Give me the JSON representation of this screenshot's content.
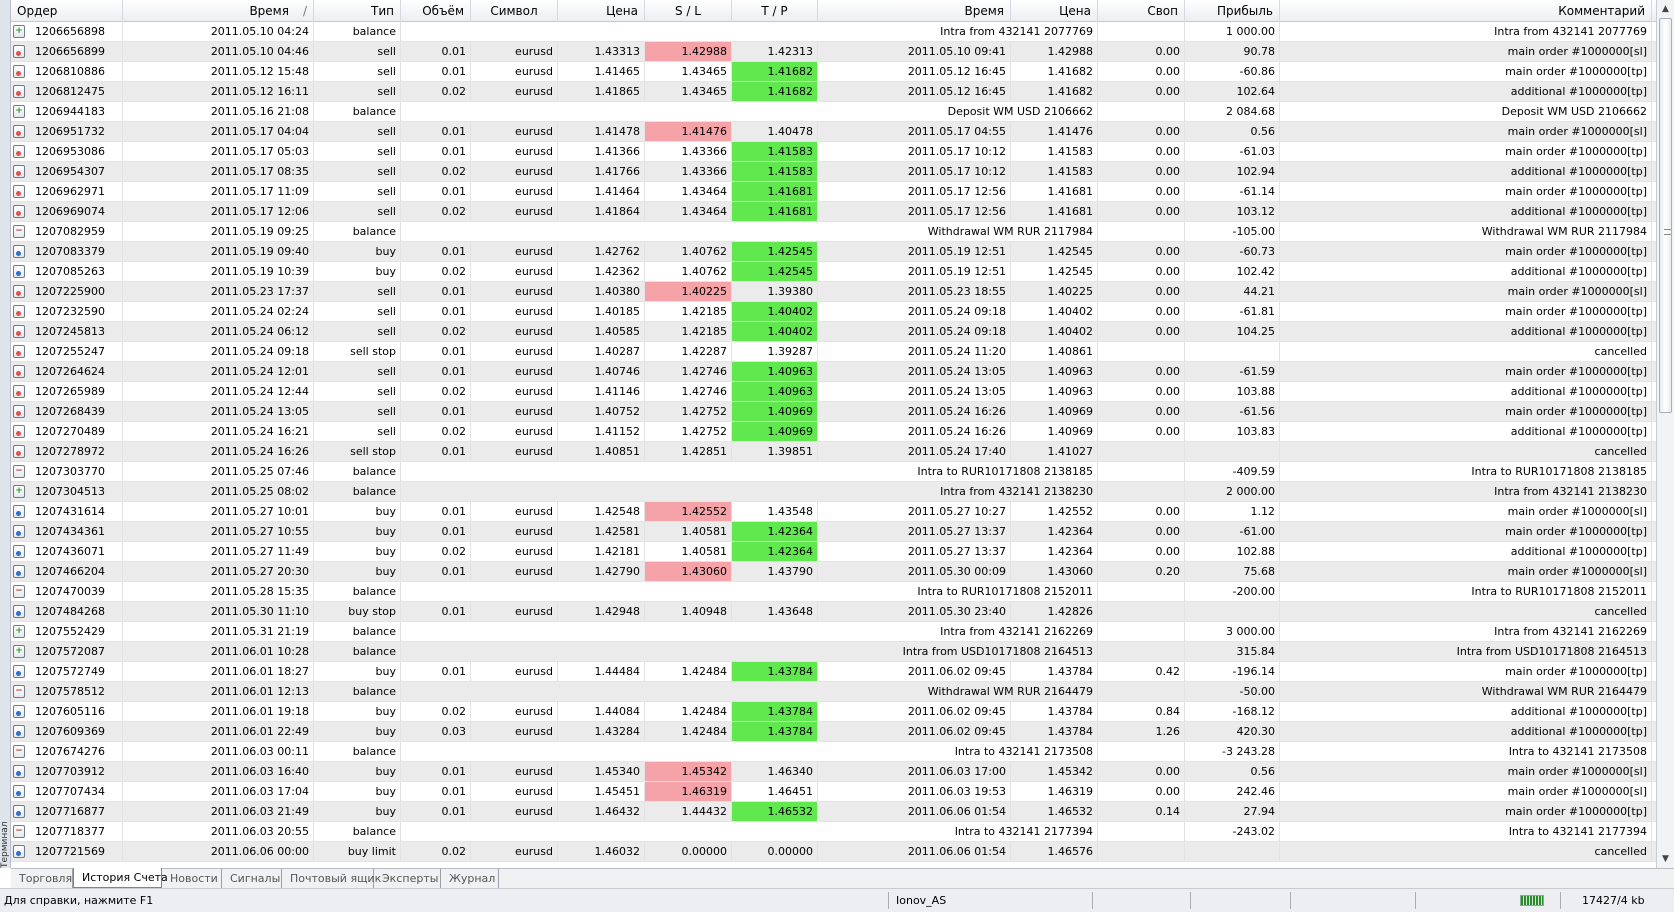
{
  "side_label": "Терминал",
  "columns": [
    "Ордер",
    "Время",
    "Тип",
    "Объём",
    "Символ",
    "Цена",
    "S / L",
    "T / P",
    "Время",
    "Цена",
    "Своп",
    "Прибыль",
    "Комментарий"
  ],
  "sort_indicator": "/",
  "rows": [
    {
      "o": "1206656898",
      "t": "2011.05.10 04:24",
      "ty": "balance",
      "v": "",
      "s": "",
      "p": "",
      "sl": "",
      "tp": "",
      "ct": "",
      "cp": "Intra from 432141 2077769",
      "sw": "",
      "pr": "1 000.00",
      "cm": "Intra from 432141 2077769",
      "hit": ""
    },
    {
      "o": "1206656899",
      "t": "2011.05.10 04:46",
      "ty": "sell",
      "v": "0.01",
      "s": "eurusd",
      "p": "1.43313",
      "sl": "1.42988",
      "tp": "1.42313",
      "ct": "2011.05.10 09:41",
      "cp": "1.42988",
      "sw": "0.00",
      "pr": "90.78",
      "cm": "main order #1000000[sl]",
      "hit": "sl"
    },
    {
      "o": "1206810886",
      "t": "2011.05.12 15:48",
      "ty": "sell",
      "v": "0.01",
      "s": "eurusd",
      "p": "1.41465",
      "sl": "1.43465",
      "tp": "1.41682",
      "ct": "2011.05.12 16:45",
      "cp": "1.41682",
      "sw": "0.00",
      "pr": "-60.86",
      "cm": "main order #1000000[tp]",
      "hit": "tp"
    },
    {
      "o": "1206812475",
      "t": "2011.05.12 16:11",
      "ty": "sell",
      "v": "0.02",
      "s": "eurusd",
      "p": "1.41865",
      "sl": "1.43465",
      "tp": "1.41682",
      "ct": "2011.05.12 16:45",
      "cp": "1.41682",
      "sw": "0.00",
      "pr": "102.64",
      "cm": "additional #1000000[tp]",
      "hit": "tp"
    },
    {
      "o": "1206944183",
      "t": "2011.05.16 21:08",
      "ty": "balance",
      "v": "",
      "s": "",
      "p": "",
      "sl": "",
      "tp": "",
      "ct": "",
      "cp": "Deposit WM USD 2106662",
      "sw": "",
      "pr": "2 084.68",
      "cm": "Deposit WM USD 2106662",
      "hit": ""
    },
    {
      "o": "1206951732",
      "t": "2011.05.17 04:04",
      "ty": "sell",
      "v": "0.01",
      "s": "eurusd",
      "p": "1.41478",
      "sl": "1.41476",
      "tp": "1.40478",
      "ct": "2011.05.17 04:55",
      "cp": "1.41476",
      "sw": "0.00",
      "pr": "0.56",
      "cm": "main order #1000000[sl]",
      "hit": "sl"
    },
    {
      "o": "1206953086",
      "t": "2011.05.17 05:03",
      "ty": "sell",
      "v": "0.01",
      "s": "eurusd",
      "p": "1.41366",
      "sl": "1.43366",
      "tp": "1.41583",
      "ct": "2011.05.17 10:12",
      "cp": "1.41583",
      "sw": "0.00",
      "pr": "-61.03",
      "cm": "main order #1000000[tp]",
      "hit": "tp"
    },
    {
      "o": "1206954307",
      "t": "2011.05.17 08:35",
      "ty": "sell",
      "v": "0.02",
      "s": "eurusd",
      "p": "1.41766",
      "sl": "1.43366",
      "tp": "1.41583",
      "ct": "2011.05.17 10:12",
      "cp": "1.41583",
      "sw": "0.00",
      "pr": "102.94",
      "cm": "additional #1000000[tp]",
      "hit": "tp"
    },
    {
      "o": "1206962971",
      "t": "2011.05.17 11:09",
      "ty": "sell",
      "v": "0.01",
      "s": "eurusd",
      "p": "1.41464",
      "sl": "1.43464",
      "tp": "1.41681",
      "ct": "2011.05.17 12:56",
      "cp": "1.41681",
      "sw": "0.00",
      "pr": "-61.14",
      "cm": "main order #1000000[tp]",
      "hit": "tp"
    },
    {
      "o": "1206969074",
      "t": "2011.05.17 12:06",
      "ty": "sell",
      "v": "0.02",
      "s": "eurusd",
      "p": "1.41864",
      "sl": "1.43464",
      "tp": "1.41681",
      "ct": "2011.05.17 12:56",
      "cp": "1.41681",
      "sw": "0.00",
      "pr": "103.12",
      "cm": "additional #1000000[tp]",
      "hit": "tp"
    },
    {
      "o": "1207082959",
      "t": "2011.05.19 09:25",
      "ty": "balance",
      "v": "",
      "s": "",
      "p": "",
      "sl": "",
      "tp": "",
      "ct": "",
      "cp": "Withdrawal WM RUR 2117984",
      "sw": "",
      "pr": "-105.00",
      "cm": "Withdrawal WM RUR 2117984",
      "hit": ""
    },
    {
      "o": "1207083379",
      "t": "2011.05.19 09:40",
      "ty": "buy",
      "v": "0.01",
      "s": "eurusd",
      "p": "1.42762",
      "sl": "1.40762",
      "tp": "1.42545",
      "ct": "2011.05.19 12:51",
      "cp": "1.42545",
      "sw": "0.00",
      "pr": "-60.73",
      "cm": "main order #1000000[tp]",
      "hit": "tp"
    },
    {
      "o": "1207085263",
      "t": "2011.05.19 10:39",
      "ty": "buy",
      "v": "0.02",
      "s": "eurusd",
      "p": "1.42362",
      "sl": "1.40762",
      "tp": "1.42545",
      "ct": "2011.05.19 12:51",
      "cp": "1.42545",
      "sw": "0.00",
      "pr": "102.42",
      "cm": "additional #1000000[tp]",
      "hit": "tp"
    },
    {
      "o": "1207225900",
      "t": "2011.05.23 17:37",
      "ty": "sell",
      "v": "0.01",
      "s": "eurusd",
      "p": "1.40380",
      "sl": "1.40225",
      "tp": "1.39380",
      "ct": "2011.05.23 18:55",
      "cp": "1.40225",
      "sw": "0.00",
      "pr": "44.21",
      "cm": "main order #1000000[sl]",
      "hit": "sl"
    },
    {
      "o": "1207232590",
      "t": "2011.05.24 02:24",
      "ty": "sell",
      "v": "0.01",
      "s": "eurusd",
      "p": "1.40185",
      "sl": "1.42185",
      "tp": "1.40402",
      "ct": "2011.05.24 09:18",
      "cp": "1.40402",
      "sw": "0.00",
      "pr": "-61.81",
      "cm": "main order #1000000[tp]",
      "hit": "tp"
    },
    {
      "o": "1207245813",
      "t": "2011.05.24 06:12",
      "ty": "sell",
      "v": "0.02",
      "s": "eurusd",
      "p": "1.40585",
      "sl": "1.42185",
      "tp": "1.40402",
      "ct": "2011.05.24 09:18",
      "cp": "1.40402",
      "sw": "0.00",
      "pr": "104.25",
      "cm": "additional #1000000[tp]",
      "hit": "tp"
    },
    {
      "o": "1207255247",
      "t": "2011.05.24 09:18",
      "ty": "sell stop",
      "v": "0.01",
      "s": "eurusd",
      "p": "1.40287",
      "sl": "1.42287",
      "tp": "1.39287",
      "ct": "2011.05.24 11:20",
      "cp": "1.40861",
      "sw": "",
      "pr": "",
      "cm": "cancelled",
      "hit": ""
    },
    {
      "o": "1207264624",
      "t": "2011.05.24 12:01",
      "ty": "sell",
      "v": "0.01",
      "s": "eurusd",
      "p": "1.40746",
      "sl": "1.42746",
      "tp": "1.40963",
      "ct": "2011.05.24 13:05",
      "cp": "1.40963",
      "sw": "0.00",
      "pr": "-61.59",
      "cm": "main order #1000000[tp]",
      "hit": "tp"
    },
    {
      "o": "1207265989",
      "t": "2011.05.24 12:44",
      "ty": "sell",
      "v": "0.02",
      "s": "eurusd",
      "p": "1.41146",
      "sl": "1.42746",
      "tp": "1.40963",
      "ct": "2011.05.24 13:05",
      "cp": "1.40963",
      "sw": "0.00",
      "pr": "103.88",
      "cm": "additional #1000000[tp]",
      "hit": "tp"
    },
    {
      "o": "1207268439",
      "t": "2011.05.24 13:05",
      "ty": "sell",
      "v": "0.01",
      "s": "eurusd",
      "p": "1.40752",
      "sl": "1.42752",
      "tp": "1.40969",
      "ct": "2011.05.24 16:26",
      "cp": "1.40969",
      "sw": "0.00",
      "pr": "-61.56",
      "cm": "main order #1000000[tp]",
      "hit": "tp"
    },
    {
      "o": "1207270489",
      "t": "2011.05.24 16:21",
      "ty": "sell",
      "v": "0.02",
      "s": "eurusd",
      "p": "1.41152",
      "sl": "1.42752",
      "tp": "1.40969",
      "ct": "2011.05.24 16:26",
      "cp": "1.40969",
      "sw": "0.00",
      "pr": "103.83",
      "cm": "additional #1000000[tp]",
      "hit": "tp"
    },
    {
      "o": "1207278972",
      "t": "2011.05.24 16:26",
      "ty": "sell stop",
      "v": "0.01",
      "s": "eurusd",
      "p": "1.40851",
      "sl": "1.42851",
      "tp": "1.39851",
      "ct": "2011.05.24 17:40",
      "cp": "1.41027",
      "sw": "",
      "pr": "",
      "cm": "cancelled",
      "hit": ""
    },
    {
      "o": "1207303770",
      "t": "2011.05.25 07:46",
      "ty": "balance",
      "v": "",
      "s": "",
      "p": "",
      "sl": "",
      "tp": "",
      "ct": "",
      "cp": "Intra to RUR10171808 2138185",
      "sw": "",
      "pr": "-409.59",
      "cm": "Intra to RUR10171808 2138185",
      "hit": ""
    },
    {
      "o": "1207304513",
      "t": "2011.05.25 08:02",
      "ty": "balance",
      "v": "",
      "s": "",
      "p": "",
      "sl": "",
      "tp": "",
      "ct": "",
      "cp": "Intra from 432141 2138230",
      "sw": "",
      "pr": "2 000.00",
      "cm": "Intra from 432141 2138230",
      "hit": ""
    },
    {
      "o": "1207431614",
      "t": "2011.05.27 10:01",
      "ty": "buy",
      "v": "0.01",
      "s": "eurusd",
      "p": "1.42548",
      "sl": "1.42552",
      "tp": "1.43548",
      "ct": "2011.05.27 10:27",
      "cp": "1.42552",
      "sw": "0.00",
      "pr": "1.12",
      "cm": "main order #1000000[sl]",
      "hit": "sl"
    },
    {
      "o": "1207434361",
      "t": "2011.05.27 10:55",
      "ty": "buy",
      "v": "0.01",
      "s": "eurusd",
      "p": "1.42581",
      "sl": "1.40581",
      "tp": "1.42364",
      "ct": "2011.05.27 13:37",
      "cp": "1.42364",
      "sw": "0.00",
      "pr": "-61.00",
      "cm": "main order #1000000[tp]",
      "hit": "tp"
    },
    {
      "o": "1207436071",
      "t": "2011.05.27 11:49",
      "ty": "buy",
      "v": "0.02",
      "s": "eurusd",
      "p": "1.42181",
      "sl": "1.40581",
      "tp": "1.42364",
      "ct": "2011.05.27 13:37",
      "cp": "1.42364",
      "sw": "0.00",
      "pr": "102.88",
      "cm": "additional #1000000[tp]",
      "hit": "tp"
    },
    {
      "o": "1207466204",
      "t": "2011.05.27 20:30",
      "ty": "buy",
      "v": "0.01",
      "s": "eurusd",
      "p": "1.42790",
      "sl": "1.43060",
      "tp": "1.43790",
      "ct": "2011.05.30 00:09",
      "cp": "1.43060",
      "sw": "0.20",
      "pr": "75.68",
      "cm": "main order #1000000[sl]",
      "hit": "sl"
    },
    {
      "o": "1207470039",
      "t": "2011.05.28 15:35",
      "ty": "balance",
      "v": "",
      "s": "",
      "p": "",
      "sl": "",
      "tp": "",
      "ct": "",
      "cp": "Intra to RUR10171808 2152011",
      "sw": "",
      "pr": "-200.00",
      "cm": "Intra to RUR10171808 2152011",
      "hit": ""
    },
    {
      "o": "1207484268",
      "t": "2011.05.30 11:10",
      "ty": "buy stop",
      "v": "0.01",
      "s": "eurusd",
      "p": "1.42948",
      "sl": "1.40948",
      "tp": "1.43648",
      "ct": "2011.05.30 23:40",
      "cp": "1.42826",
      "sw": "",
      "pr": "",
      "cm": "cancelled",
      "hit": ""
    },
    {
      "o": "1207552429",
      "t": "2011.05.31 21:19",
      "ty": "balance",
      "v": "",
      "s": "",
      "p": "",
      "sl": "",
      "tp": "",
      "ct": "",
      "cp": "Intra from 432141 2162269",
      "sw": "",
      "pr": "3 000.00",
      "cm": "Intra from 432141 2162269",
      "hit": ""
    },
    {
      "o": "1207572087",
      "t": "2011.06.01 10:28",
      "ty": "balance",
      "v": "",
      "s": "",
      "p": "",
      "sl": "",
      "tp": "",
      "ct": "",
      "cp": "Intra from USD10171808 2164513",
      "sw": "",
      "pr": "315.84",
      "cm": "Intra from USD10171808 2164513",
      "hit": ""
    },
    {
      "o": "1207572749",
      "t": "2011.06.01 18:27",
      "ty": "buy",
      "v": "0.01",
      "s": "eurusd",
      "p": "1.44484",
      "sl": "1.42484",
      "tp": "1.43784",
      "ct": "2011.06.02 09:45",
      "cp": "1.43784",
      "sw": "0.42",
      "pr": "-196.14",
      "cm": "main order #1000000[tp]",
      "hit": "tp"
    },
    {
      "o": "1207578512",
      "t": "2011.06.01 12:13",
      "ty": "balance",
      "v": "",
      "s": "",
      "p": "",
      "sl": "",
      "tp": "",
      "ct": "",
      "cp": "Withdrawal WM RUR 2164479",
      "sw": "",
      "pr": "-50.00",
      "cm": "Withdrawal WM RUR 2164479",
      "hit": ""
    },
    {
      "o": "1207605116",
      "t": "2011.06.01 19:18",
      "ty": "buy",
      "v": "0.02",
      "s": "eurusd",
      "p": "1.44084",
      "sl": "1.42484",
      "tp": "1.43784",
      "ct": "2011.06.02 09:45",
      "cp": "1.43784",
      "sw": "0.84",
      "pr": "-168.12",
      "cm": "additional #1000000[tp]",
      "hit": "tp"
    },
    {
      "o": "1207609369",
      "t": "2011.06.01 22:49",
      "ty": "buy",
      "v": "0.03",
      "s": "eurusd",
      "p": "1.43284",
      "sl": "1.42484",
      "tp": "1.43784",
      "ct": "2011.06.02 09:45",
      "cp": "1.43784",
      "sw": "1.26",
      "pr": "420.30",
      "cm": "additional #1000000[tp]",
      "hit": "tp"
    },
    {
      "o": "1207674276",
      "t": "2011.06.03 00:11",
      "ty": "balance",
      "v": "",
      "s": "",
      "p": "",
      "sl": "",
      "tp": "",
      "ct": "",
      "cp": "Intra to 432141 2173508",
      "sw": "",
      "pr": "-3 243.28",
      "cm": "Intra to 432141 2173508",
      "hit": ""
    },
    {
      "o": "1207703912",
      "t": "2011.06.03 16:40",
      "ty": "buy",
      "v": "0.01",
      "s": "eurusd",
      "p": "1.45340",
      "sl": "1.45342",
      "tp": "1.46340",
      "ct": "2011.06.03 17:00",
      "cp": "1.45342",
      "sw": "0.00",
      "pr": "0.56",
      "cm": "main order #1000000[sl]",
      "hit": "sl"
    },
    {
      "o": "1207707434",
      "t": "2011.06.03 17:04",
      "ty": "buy",
      "v": "0.01",
      "s": "eurusd",
      "p": "1.45451",
      "sl": "1.46319",
      "tp": "1.46451",
      "ct": "2011.06.03 19:53",
      "cp": "1.46319",
      "sw": "0.00",
      "pr": "242.46",
      "cm": "main order #1000000[sl]",
      "hit": "sl"
    },
    {
      "o": "1207716877",
      "t": "2011.06.03 21:49",
      "ty": "buy",
      "v": "0.01",
      "s": "eurusd",
      "p": "1.46432",
      "sl": "1.44432",
      "tp": "1.46532",
      "ct": "2011.06.06 01:54",
      "cp": "1.46532",
      "sw": "0.14",
      "pr": "27.94",
      "cm": "main order #1000000[tp]",
      "hit": "tp"
    },
    {
      "o": "1207718377",
      "t": "2011.06.03 20:55",
      "ty": "balance",
      "v": "",
      "s": "",
      "p": "",
      "sl": "",
      "tp": "",
      "ct": "",
      "cp": "Intra to 432141 2177394",
      "sw": "",
      "pr": "-243.02",
      "cm": "Intra to 432141 2177394",
      "hit": ""
    },
    {
      "o": "1207721569",
      "t": "2011.06.06 00:00",
      "ty": "buy limit",
      "v": "0.02",
      "s": "eurusd",
      "p": "1.46032",
      "sl": "0.00000",
      "tp": "0.00000",
      "ct": "2011.06.06 01:54",
      "cp": "1.46576",
      "sw": "",
      "pr": "",
      "cm": "cancelled",
      "hit": ""
    }
  ],
  "tabs": [
    "Торговля",
    "История Счета",
    "Новости",
    "Сигналы",
    "Почтовый ящик",
    "Эксперты",
    "Журнал"
  ],
  "active_tab": 1,
  "status": {
    "help": "Для справки, нажмите F1",
    "profile": "Ionov_AS",
    "traffic": "17427/4 kb"
  },
  "colors": {
    "tp_hit": "#61e84f",
    "sl_hit": "#f5a3a8",
    "alt_row": "#ebebeb"
  }
}
